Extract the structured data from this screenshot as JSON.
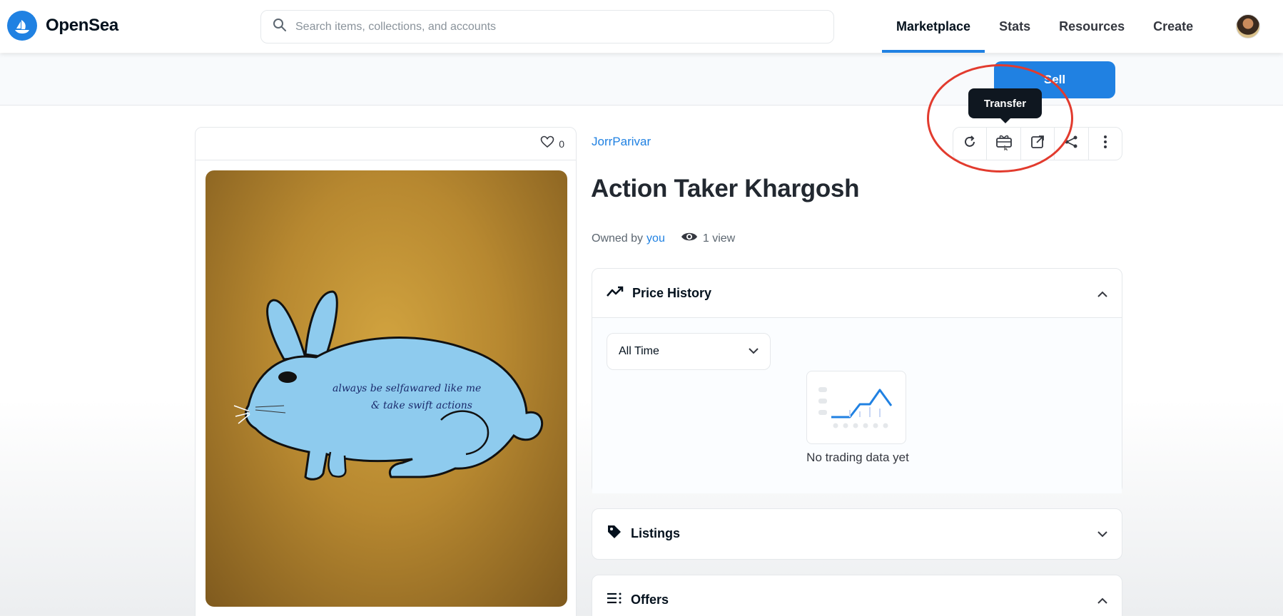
{
  "brand": {
    "name": "OpenSea"
  },
  "search": {
    "placeholder": "Search items, collections, and accounts"
  },
  "nav": {
    "items": [
      {
        "label": "Marketplace",
        "active": true
      },
      {
        "label": "Stats"
      },
      {
        "label": "Resources"
      },
      {
        "label": "Create"
      }
    ]
  },
  "toolbar": {
    "sell_label": "Sell"
  },
  "tooltip": {
    "text": "Transfer"
  },
  "item": {
    "favorites": "0",
    "collection": "JorrParivar",
    "title": "Action Taker Khargosh",
    "owned_by_label": "Owned by",
    "owner": "you",
    "views": "1 view",
    "art_text_line1": "always be selfawared like me",
    "art_text_line2": "& take swift actions"
  },
  "price_history": {
    "title": "Price History",
    "time_filter": "All Time",
    "empty_text": "No trading data yet"
  },
  "listings": {
    "title": "Listings"
  },
  "offers": {
    "title": "Offers"
  },
  "colors": {
    "accent": "#2081e2",
    "highlight": "#e23b2e",
    "tooltip_bg": "#0f1720",
    "art_bg": "#b78830",
    "rabbit": "#8ecbee"
  }
}
